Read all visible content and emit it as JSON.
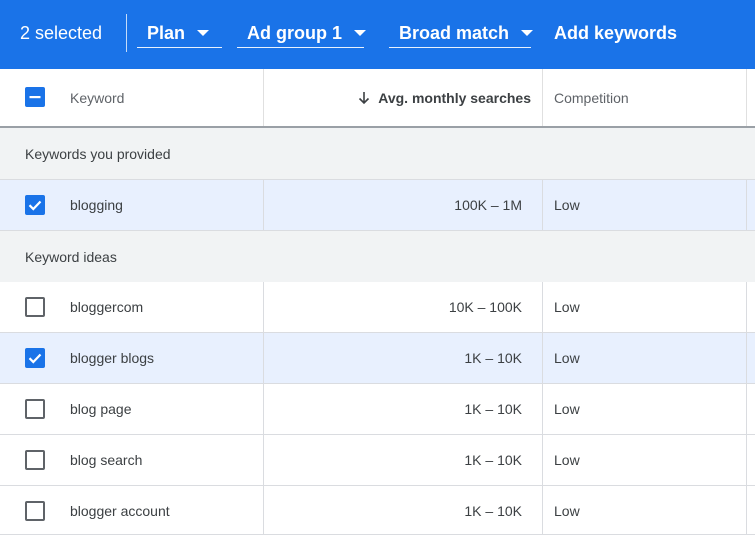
{
  "toolbar": {
    "selected_count": "2 selected",
    "plan_label": "Plan",
    "ad_group_label": "Ad group 1",
    "match_type_label": "Broad match",
    "add_keywords_label": "Add keywords"
  },
  "table": {
    "headers": {
      "keyword": "Keyword",
      "avg_monthly_searches": "Avg. monthly searches",
      "competition": "Competition"
    },
    "sort_icon": "arrow-down-icon",
    "header_checkbox_state": "indeterminate",
    "sections": [
      {
        "title": "Keywords you provided",
        "rows": [
          {
            "keyword": "blogging",
            "avg": "100K – 1M",
            "competition": "Low",
            "checked": true
          }
        ]
      },
      {
        "title": "Keyword ideas",
        "rows": [
          {
            "keyword": "bloggercom",
            "avg": "10K – 100K",
            "competition": "Low",
            "checked": false
          },
          {
            "keyword": "blogger blogs",
            "avg": "1K – 10K",
            "competition": "Low",
            "checked": true
          },
          {
            "keyword": "blog page",
            "avg": "1K – 10K",
            "competition": "Low",
            "checked": false
          },
          {
            "keyword": "blog search",
            "avg": "1K – 10K",
            "competition": "Low",
            "checked": false
          },
          {
            "keyword": "blogger account",
            "avg": "1K – 10K",
            "competition": "Low",
            "checked": false
          }
        ]
      }
    ]
  },
  "colors": {
    "accent": "#1a73e8",
    "selected_row": "#e8f0fe",
    "section_bg": "#f1f3f4"
  }
}
